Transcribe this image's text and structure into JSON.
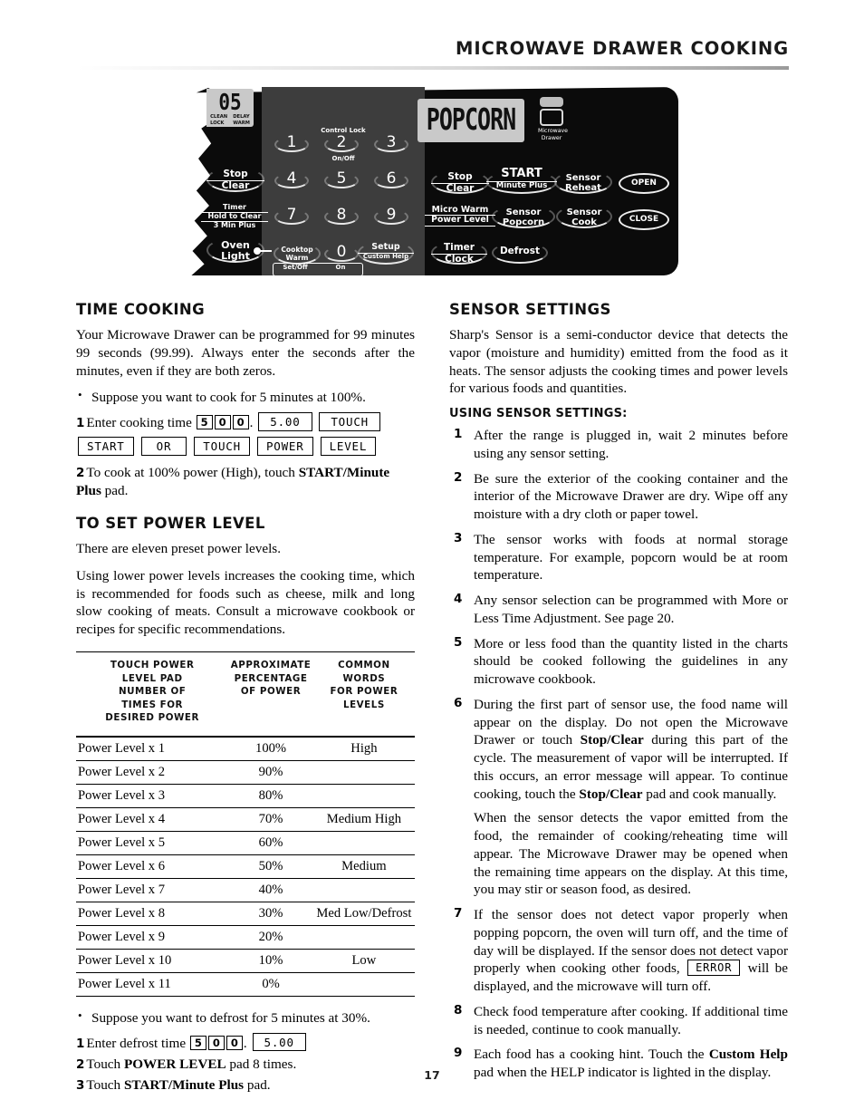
{
  "header": {
    "title": "MICROWAVE DRAWER COOKING"
  },
  "control_panel": {
    "left_display": {
      "digits": "05",
      "tag_clean": "CLEAN",
      "tag_lock": "LOCK",
      "tag_delay": "DELAY",
      "tag_warm": "WARM"
    },
    "main_display": "POPCORN",
    "drawer_icon_label_line1": "Microwave",
    "drawer_icon_label_line2": "Drawer",
    "left_keys": [
      {
        "line1": "Stop",
        "line2": "Clear"
      },
      {
        "line1": "Timer",
        "line2": "Hold to Clear",
        "line3": "3 Min Plus"
      },
      {
        "line1": "Oven",
        "line2": "Light"
      }
    ],
    "keypad": {
      "control_lock_label": "Control Lock",
      "on_off_label": "On/Off",
      "digits": [
        "1",
        "2",
        "3",
        "4",
        "5",
        "6",
        "7",
        "8",
        "9",
        "0"
      ],
      "cooktop_warm_line1": "Cooktop",
      "cooktop_warm_line2": "Warm",
      "setup_line1": "Setup",
      "setup_line2": "Custom Help",
      "set_off_label": "Set/Off",
      "on_label": "On"
    },
    "right_keys": [
      {
        "line1": "Stop",
        "line2": "Clear"
      },
      {
        "line1": "START",
        "line2": "Minute Plus"
      },
      {
        "line1": "Sensor",
        "line2": "Reheat"
      },
      {
        "line1": "OPEN"
      },
      {
        "line1": "Micro Warm",
        "line2": "Power Level"
      },
      {
        "line1": "Sensor",
        "line2": "Popcorn"
      },
      {
        "line1": "Sensor",
        "line2": "Cook"
      },
      {
        "line1": "CLOSE"
      },
      {
        "line1": "Timer",
        "line2": "Clock"
      },
      {
        "line1": "Defrost"
      }
    ]
  },
  "left_column": {
    "time_cooking": {
      "heading": "TIME COOKING",
      "intro": "Your Microwave Drawer can be programmed for 99 minutes 99 seconds (99.99). Always enter the seconds after the minutes, even if they are both zeros.",
      "bullet": "Suppose you want to cook for 5 minutes at 100%.",
      "step1_num": "1",
      "step1_text_a": "Enter cooking time",
      "step1_keys": [
        "5",
        "0",
        "0"
      ],
      "step1_period": ".",
      "step1_lcd_time": "5.00",
      "step1_lcd_touch": "TOUCH",
      "step1_lcd_row": [
        "START",
        "OR",
        "TOUCH",
        "POWER",
        "LEVEL"
      ],
      "step2_num": "2",
      "step2_text_a": "To cook at 100% power (High), touch ",
      "step2_bold": "START/Minute Plus",
      "step2_text_b": " pad."
    },
    "power_level": {
      "heading": "TO SET POWER LEVEL",
      "para1": "There are eleven preset power levels.",
      "para2": "Using lower power levels increases the cooking time, which is recommended for foods such as cheese, milk and long slow cooking of meats. Consult a microwave cookbook or recipes for specific recommendations."
    },
    "table": {
      "headers": [
        "TOUCH POWER LEVEL PAD NUMBER OF TIMES FOR DESIRED POWER",
        "APPROXIMATE PERCENTAGE OF POWER",
        "COMMON WORDS FOR POWER LEVELS"
      ],
      "header_lines": [
        [
          "TOUCH POWER",
          "LEVEL PAD",
          "NUMBER OF",
          "TIMES FOR",
          "DESIRED POWER"
        ],
        [
          "APPROXIMATE",
          "PERCENTAGE",
          "OF POWER"
        ],
        [
          "COMMON",
          "WORDS",
          "FOR POWER",
          "LEVELS"
        ]
      ],
      "rows": [
        {
          "pad": "Power Level x 1",
          "pct": "100%",
          "word": "High"
        },
        {
          "pad": "Power Level x 2",
          "pct": "90%",
          "word": ""
        },
        {
          "pad": "Power Level x 3",
          "pct": "80%",
          "word": ""
        },
        {
          "pad": "Power Level x 4",
          "pct": "70%",
          "word": "Medium High"
        },
        {
          "pad": "Power Level x 5",
          "pct": "60%",
          "word": ""
        },
        {
          "pad": "Power Level x 6",
          "pct": "50%",
          "word": "Medium"
        },
        {
          "pad": "Power Level x 7",
          "pct": "40%",
          "word": ""
        },
        {
          "pad": "Power Level x 8",
          "pct": "30%",
          "word": "Med Low/Defrost"
        },
        {
          "pad": "Power Level x 9",
          "pct": "20%",
          "word": ""
        },
        {
          "pad": "Power Level x 10",
          "pct": "10%",
          "word": "Low"
        },
        {
          "pad": "Power Level x 11",
          "pct": "0%",
          "word": ""
        }
      ]
    },
    "defrost_example": {
      "bullet": "Suppose you want to defrost for 5 minutes at 30%.",
      "step1_num": "1",
      "step1_text_a": "Enter defrost time",
      "step1_keys": [
        "5",
        "0",
        "0"
      ],
      "step1_period": ".",
      "step1_lcd_time": "5.00",
      "step2_num": "2",
      "step2_text_a": "Touch ",
      "step2_bold": "POWER LEVEL",
      "step2_text_b": " pad 8 times.",
      "step3_num": "3",
      "step3_text_a": "Touch ",
      "step3_bold": "START/Minute Plus",
      "step3_text_b": " pad."
    }
  },
  "right_column": {
    "sensor_settings": {
      "heading": "SENSOR SETTINGS",
      "intro": "Sharp's Sensor is a semi-conductor device that detects the vapor (moisture and humidity) emitted from the food as it heats. The sensor adjusts the cooking times and power levels for various foods and quantities.",
      "subheading": "USING SENSOR SETTINGS:",
      "items": [
        {
          "num": "1",
          "text": "After the range is plugged in, wait 2 minutes before using any sensor setting."
        },
        {
          "num": "2",
          "text": "Be sure the exterior of the cooking container and the interior of the Microwave Drawer are dry. Wipe off any moisture with a dry cloth or paper towel."
        },
        {
          "num": "3",
          "text": "The sensor works with foods at normal storage temperature. For example, popcorn would be at room temperature."
        },
        {
          "num": "4",
          "text": "Any sensor selection can be programmed with More or Less Time Adjustment. See page 20."
        },
        {
          "num": "5",
          "text": "More or less food than the quantity listed in the charts should be cooked following the guidelines in any microwave cookbook."
        }
      ],
      "item6": {
        "num": "6",
        "part1": "During the first part of sensor use, the food name will appear on the display. Do not open the Microwave Drawer or touch ",
        "bold1": "Stop/Clear",
        "part2": " during this part of the cycle. The measurement of vapor will be interrupted. If this occurs, an error message will appear. To continue cooking, touch the ",
        "bold2": "Stop/Clear",
        "part3": " pad and cook manually.",
        "para2": "When the sensor detects the vapor emitted from the food, the remainder of cooking/reheating time will appear. The Microwave Drawer may be opened when the remaining time appears on the display. At this time, you may stir or season food, as desired."
      },
      "item7": {
        "num": "7",
        "part1": "If the sensor does not detect vapor properly when popping popcorn, the oven will turn off, and the time of day will be displayed. If the sensor does not detect vapor properly when cooking other foods, ",
        "lcd": "ERROR",
        "part2": " will be displayed, and the microwave will turn off."
      },
      "item8": {
        "num": "8",
        "text": "Check food temperature after cooking. If additional time is needed, continue to cook manually."
      },
      "item9": {
        "num": "9",
        "part1": "Each food has a cooking hint. Touch the ",
        "bold": "Custom Help",
        "part2": " pad when the HELP indicator is lighted in the display."
      }
    }
  },
  "footer": {
    "page_number": "17"
  }
}
